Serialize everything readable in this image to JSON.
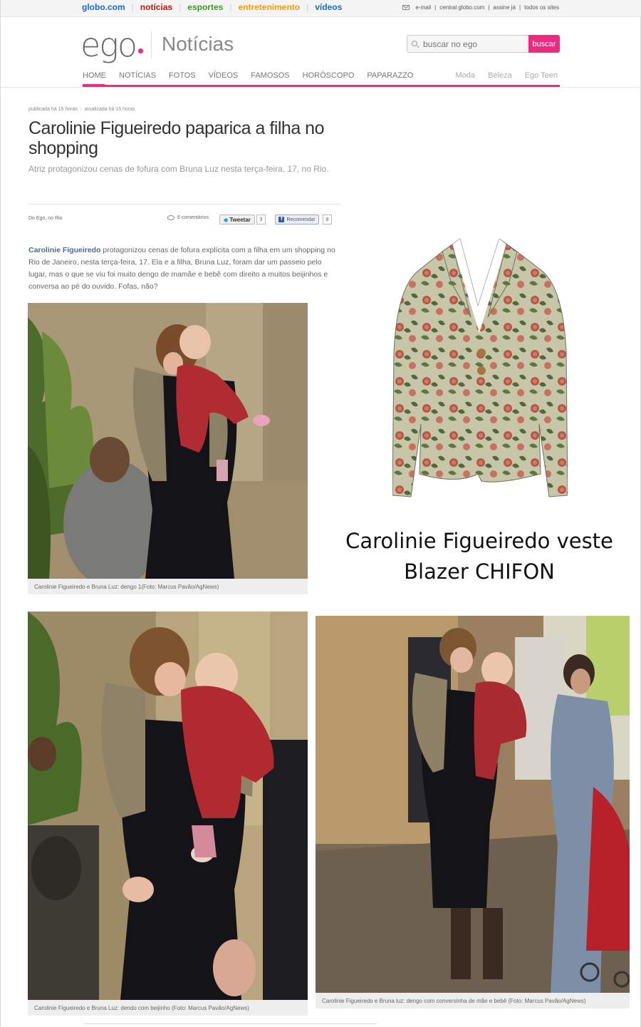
{
  "globo_bar": {
    "links": [
      {
        "label": "globo.com",
        "color": "#1a6bc4"
      },
      {
        "label": "notícias",
        "color": "#c4170c"
      },
      {
        "label": "esportes",
        "color": "#3a9e23"
      },
      {
        "label": "entretenimento",
        "color": "#f39c12"
      },
      {
        "label": "vídeos",
        "color": "#1a6bc4"
      }
    ],
    "utility": [
      "e-mail",
      "central globo.com",
      "assine já",
      "todos os sites"
    ]
  },
  "header": {
    "logo": "ego",
    "section_title": "Notícias",
    "search": {
      "placeholder": "buscar no ego",
      "button": "buscar"
    },
    "nav": [
      "HOME",
      "NOTÍCIAS",
      "FOTOS",
      "VÍDEOS",
      "FAMOSOS",
      "HORÓSCOPO",
      "PAPARAZZO"
    ],
    "nav_secondary": [
      "Moda",
      "Beleza",
      "Ego Teen"
    ],
    "accent": "#ec2a84"
  },
  "article": {
    "published": "publicada há 15 horas",
    "updated": "atualizada há 15 horas",
    "headline": "Carolinie Figueiredo paparica a filha no shopping",
    "subhead": "Atriz protagonizou cenas de fofura com Bruna Luz nesta terça-feira, 17, no Rio.",
    "byline": "Do Ego, no Rio",
    "comments": "6 comentários",
    "tweet_label": "Tweetar",
    "tweet_count": "3",
    "fb_label": "Recomendar",
    "fb_count": "8",
    "body_lead": "Carolinie Figueiredo",
    "body_rest": " protagonizou cenas de fofura explícita com a filha em um shopping no Rio de Janeiro, nesta terça-feira, 17. Ela e a filha, Bruna Luz, foram dar um passeio pelo lugar, mas o que se viu foi muito dengo de mamãe e bebê com direito a muitos beijinhos e conversa ao pé do ouvido. Fofas, não?"
  },
  "photos": {
    "caption1": "Carolinie Figueiredo e Bruna Luz: dengo 1(Foto: Marcus Pavão/AgNews)",
    "caption2": "Carolinie Figueiredo e Bruna Luz: dendo com beijinho (Foto: Marcus Pavão/AgNews)",
    "caption3": "Carolinie Figueiredo e Bruna luz: dengo com conversinha de mãe e bebê (Foto: Marcus Pavão/AgNews)"
  },
  "promo": {
    "line1": "Carolinie Figueiredo veste",
    "line2": "Blazer CHIFON"
  }
}
